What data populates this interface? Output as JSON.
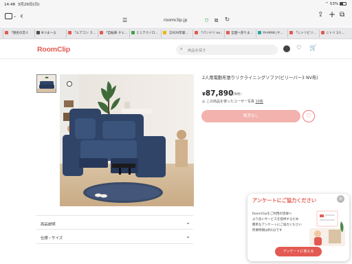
{
  "status_bar": {
    "time": "14:48",
    "date": "3月29日(日)",
    "battery": "53%"
  },
  "browser": {
    "url": "roomclip.jp",
    "tabs": [
      {
        "label": "「親名の恋人",
        "color": "#e05a4e"
      },
      {
        "label": "Nつま〜る",
        "color": "#4a4a4a"
      },
      {
        "label": "「エアコン ス…",
        "color": "#e05a4e"
      },
      {
        "label": "「自転車 チェ…",
        "color": "#e05a4e"
      },
      {
        "label": "２１テクノロ…",
        "color": "#3aa34a"
      },
      {
        "label": "【2026年最…",
        "color": "#f0b400"
      },
      {
        "label": "「パンドリ ex…",
        "color": "#e05a4e"
      },
      {
        "label": "全国へ売りま…",
        "color": "#e05a4e"
      },
      {
        "label": "YA-MAN |ヤ…",
        "color": "#2aa5a0"
      },
      {
        "label": "「ニトリビリ…",
        "color": "#e05a4e"
      },
      {
        "label": "ニトリ 2人…",
        "color": "#e05a4e"
      }
    ]
  },
  "header": {
    "logo": "RoomClip",
    "search_placeholder": "商品を探す"
  },
  "product": {
    "title": "2人用電動布張りリクライニングソファ(ビリーバー3 NV布)",
    "currency": "¥",
    "price": "87,890",
    "tax_note": "(参考価格)",
    "users_text": "この商品を使ったユーザー写真",
    "users_count": "10枚",
    "soldout_label": "販売なし"
  },
  "accordion": [
    {
      "label": "商品説明"
    },
    {
      "label": "仕様・サイズ"
    }
  ],
  "popup": {
    "title": "アンケートにご協力ください",
    "line1": "RoomClipをご利用の皆様へ",
    "line2": "より良いサービスを提供するため",
    "line3": "簡単なアンケートにご協力ください",
    "line4": "所要時間は約1分です",
    "button": "アンケートに答える"
  },
  "colors": {
    "brand": "#e25a52",
    "soldout": "#f3b2ad",
    "sofa": "#2f4467"
  }
}
